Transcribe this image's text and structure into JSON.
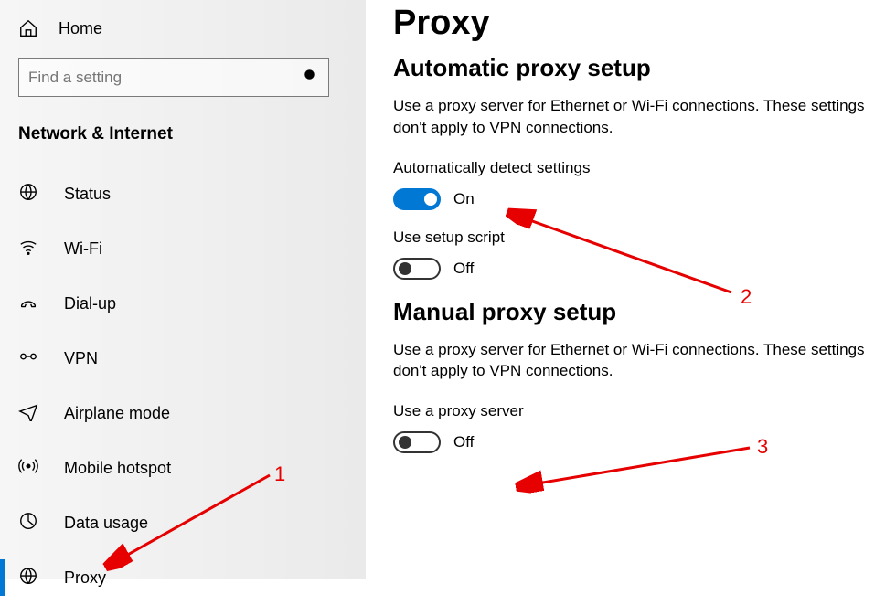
{
  "sidebar": {
    "home_label": "Home",
    "search_placeholder": "Find a setting",
    "section_title": "Network & Internet",
    "items": [
      {
        "label": "Status"
      },
      {
        "label": "Wi-Fi"
      },
      {
        "label": "Dial-up"
      },
      {
        "label": "VPN"
      },
      {
        "label": "Airplane mode"
      },
      {
        "label": "Mobile hotspot"
      },
      {
        "label": "Data usage"
      },
      {
        "label": "Proxy"
      }
    ]
  },
  "content": {
    "page_title": "Proxy",
    "auto_header": "Automatic proxy setup",
    "auto_desc": "Use a proxy server for Ethernet or Wi-Fi connections. These settings don't apply to VPN connections.",
    "auto_detect_label": "Automatically detect settings",
    "auto_detect_state": "On",
    "setup_script_label": "Use setup script",
    "setup_script_state": "Off",
    "manual_header": "Manual proxy setup",
    "manual_desc": "Use a proxy server for Ethernet or Wi-Fi connections. These settings don't apply to VPN connections.",
    "use_proxy_label": "Use a proxy server",
    "use_proxy_state": "Off"
  },
  "annotations": {
    "one": "1",
    "two": "2",
    "three": "3"
  }
}
